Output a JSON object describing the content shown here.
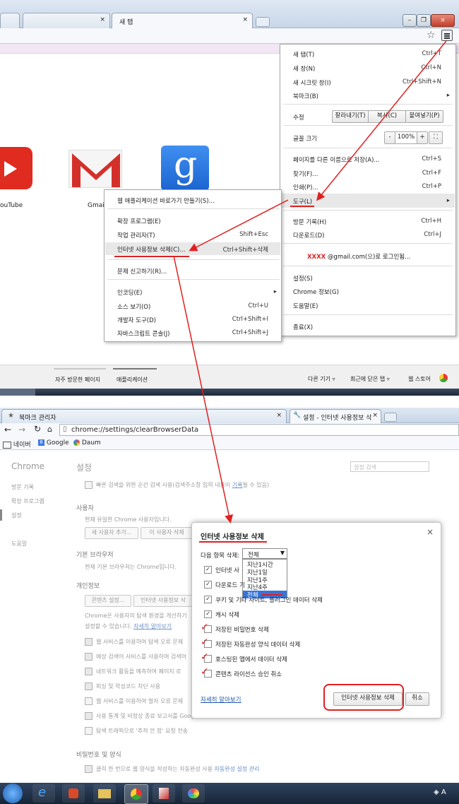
{
  "top": {
    "tab_active": "새 탭",
    "menu": {
      "new_tab": "새 탭(T)",
      "new_tab_sc": "Ctrl+T",
      "new_window": "새 창(N)",
      "new_window_sc": "Ctrl+N",
      "incognito": "새 시크릿 창(I)",
      "incognito_sc": "Ctrl+Shift+N",
      "bookmarks": "북마크(B)",
      "edit": "수정",
      "cut": "잘라내기(T)",
      "copy": "복사(C)",
      "paste": "붙여넣기(P)",
      "font_size": "글꼴 크기",
      "zoom_minus": "-",
      "zoom_value": "100%",
      "zoom_plus": "+",
      "save_as": "페이지를 다른 이름으로 저장(A)...",
      "save_as_sc": "Ctrl+S",
      "find": "찾기(F)...",
      "find_sc": "Ctrl+F",
      "print": "인쇄(P)...",
      "print_sc": "Ctrl+P",
      "tools": "도구(L)",
      "history": "방문 기록(H)",
      "history_sc": "Ctrl+H",
      "downloads": "다운로드(D)",
      "downloads_sc": "Ctrl+J",
      "signin_masked": "XXXX",
      "signin_rest": "@gmail.com(으)로 로그인됨...",
      "settings": "설정(S)",
      "about": "Chrome 정보(G)",
      "help": "도움말(E)",
      "exit": "종료(X)"
    },
    "submenu": {
      "app_shortcut": "웹 애플리케이션 바로가기 만들기(S)...",
      "extensions": "확장 프로그램(E)",
      "task_manager": "작업 관리자(T)",
      "task_manager_sc": "Shift+Esc",
      "clear_data": "인터넷 사용정보 삭제(C)...",
      "clear_data_sc": "Ctrl+Shift+삭제",
      "report": "문제 신고하기(R)...",
      "encoding": "인코딩(E)",
      "view_source": "소스 보기(O)",
      "view_source_sc": "Ctrl+U",
      "devtools": "개발자 도구(D)",
      "devtools_sc": "Ctrl+Shift+I",
      "js_console": "자바스크립트 콘솔(J)",
      "js_console_sc": "Ctrl+Shift+J"
    },
    "apps": {
      "youtube": "ouTube",
      "gmail": "Gmai"
    },
    "bottom": {
      "most_visited": "자주 방문한 페이지",
      "applications": "애플리케이션",
      "other_devices": "다른 기기 ▿",
      "recently_closed": "최근에 닫은 탭 ▿",
      "web_store": "웹 스토어"
    }
  },
  "bottom": {
    "tab1": "북마크 관리자",
    "tab2": "설정 - 인터넷 사용정보 삭",
    "url": "chrome://settings/clearBrowserData",
    "bookmarks": [
      "네이버",
      "Google",
      "Daum"
    ],
    "sidebar": {
      "title": "Chrome",
      "items": [
        "방문 기록",
        "확장 프로그램",
        "설정",
        "도움말"
      ]
    },
    "settings": {
      "title": "설정",
      "search_placeholder": "설정 검색",
      "instant_pre": "빠른 검색을 위한 순간 검색 사용(검색주소창 입력 내용이 ",
      "instant_link": "기록",
      "instant_post": "될 수 있음)",
      "users_h": "사용자",
      "users_desc": "현재 유일한 Chrome 사용자입니다.",
      "add_user": "새 사용자 추가...",
      "delete_user": "이 사용자 삭제",
      "default_browser_h": "기본 브라우저",
      "default_browser_desc": "현재 기본 브라우저는 Chrome입니다.",
      "privacy_h": "개인정보",
      "content_settings": "콘텐츠 설정...",
      "clear_browsing": "인터넷 사용정보 삭",
      "privacy_desc1": "Chrome은 사용자의 탐색 환경을 개선하기",
      "privacy_desc2_pre": "설정할 수 있습니다. ",
      "privacy_desc2_link": "자세히 알아보기",
      "privacy_items": [
        "웹 서비스를 이용하여 탐색 오류 문제",
        "예상 검색어 서비스를 사용하여 검색어",
        "네트워크 활동을 예측하여 페이지 로",
        "피싱 및 악성코드 차단 사용",
        "웹 서비스를 이용하여 철자 오류 문제",
        "사용 통계 및 비정상 종료 보고서를 Google에 자동으로 보내기",
        "탐색 트래픽으로 '추적 안 함' 요청 전송"
      ],
      "passwords_h": "비밀번호 및 양식",
      "autofill_pre": "클릭 한 번으로 웹 양식을 작성하는 자동완성 사용 ",
      "autofill_link": "자동완성 설정 관리"
    },
    "dialog": {
      "title": "인터넷 사용정보 삭제",
      "close": "×",
      "period_label": "다음 항목 삭제:",
      "period_value": "전체",
      "period_options": [
        "지난1시간",
        "지난1일",
        "지난1주",
        "지난4주",
        "전체"
      ],
      "items": [
        "인터넷 사",
        "다운로드 기",
        "쿠키 및 기타 사이트, 플러그인 데이터 삭제",
        "캐시 삭제",
        "저장된 비밀번호 삭제",
        "저장된 자동완성 양식 데이터 삭제",
        "호스팅된 앱에서 데이터 삭제",
        "콘텐츠 라이선스 승인 취소"
      ],
      "learn_more": "자세히 알아보기",
      "clear_button": "인터넷 사용정보 삭제",
      "cancel_button": "취소"
    },
    "tray": "A"
  },
  "colors": {
    "accent_red": "#e02020",
    "link": "#2255aa",
    "tab_blue": "#c8d6e8"
  }
}
